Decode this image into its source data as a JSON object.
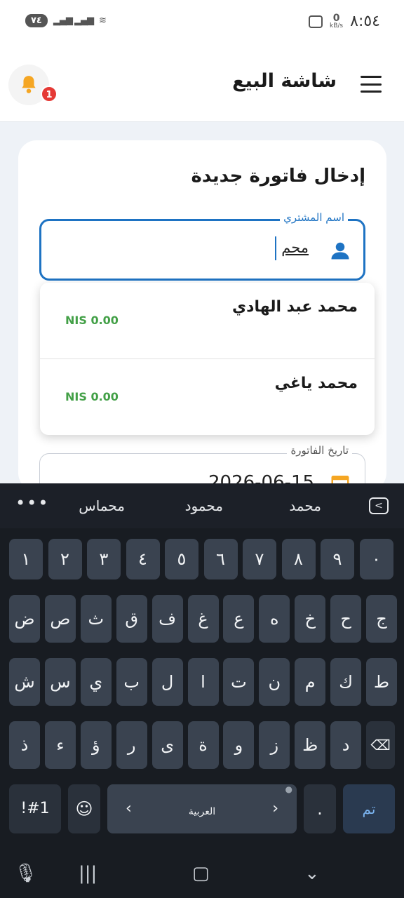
{
  "status_bar": {
    "time": "٨:٥٤",
    "battery": "٧٤",
    "network_speed": "0",
    "network_unit": "kB/s"
  },
  "app_bar": {
    "title": "شاشة البيع",
    "notification_count": "1"
  },
  "form": {
    "title": "إدخال فاتورة جديدة",
    "buyer_label": "اسم المشتري",
    "buyer_value": "محم",
    "date_label": "تاريخ الفاتورة",
    "date_value": "2026-06-15"
  },
  "dropdown": [
    {
      "name": "محمد عبد الهادي",
      "amount": "NIS 0.00"
    },
    {
      "name": "محمد ياغي",
      "amount": "NIS 0.00"
    }
  ],
  "keyboard": {
    "suggestions": [
      "محمد",
      "محمود",
      "محماس"
    ],
    "row1": [
      "١",
      "٢",
      "٣",
      "٤",
      "٥",
      "٦",
      "٧",
      "٨",
      "٩",
      "٠"
    ],
    "row2": [
      "ض",
      "ص",
      "ث",
      "ق",
      "ف",
      "غ",
      "ع",
      "ه",
      "خ",
      "ح",
      "ج"
    ],
    "row3": [
      "ش",
      "س",
      "ي",
      "ب",
      "ل",
      "ا",
      "ت",
      "ن",
      "م",
      "ك",
      "ط"
    ],
    "row4": [
      "ذ",
      "ء",
      "ؤ",
      "ر",
      "ى",
      "ة",
      "و",
      "ز",
      "ظ",
      "د"
    ],
    "symbols_key": "!#1",
    "language_key": "العربية",
    "period_key": ".",
    "done_key": "تم"
  },
  "colors": {
    "accent": "#1e73c3",
    "amount": "#43a047",
    "badge": "#e53935",
    "bell": "#f5a623"
  }
}
